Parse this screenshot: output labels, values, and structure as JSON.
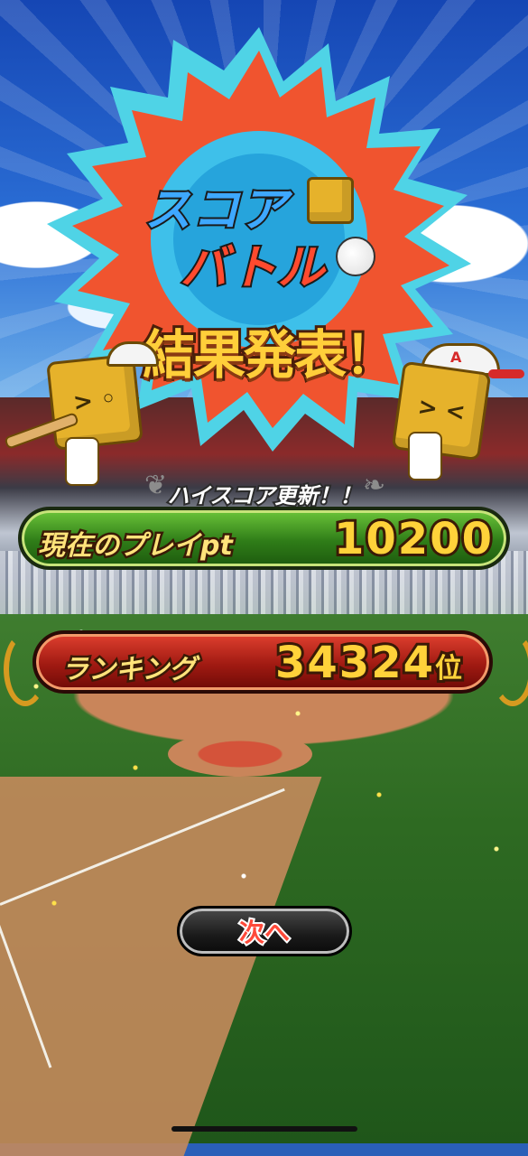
{
  "event": {
    "logo_line1": "スコア",
    "logo_line2": "バトル",
    "headline": "結果発表！"
  },
  "highscore_badge": "ハイスコア更新！！",
  "play_points": {
    "label": "現在のプレイpt",
    "value": "10200"
  },
  "ranking": {
    "label": "ランキング",
    "value": "34324",
    "suffix": "位"
  },
  "mascots": {
    "left_face": "> ◦",
    "right_face": "> <",
    "cap_letter": "A"
  },
  "next_button": {
    "label": "次へ"
  },
  "colors": {
    "burst_orange": "#f0542f",
    "burst_cyan": "#4fd3e6",
    "play_panel": "#2f7d18",
    "rank_panel": "#a01a12",
    "value_gold": "#ffd23a"
  }
}
